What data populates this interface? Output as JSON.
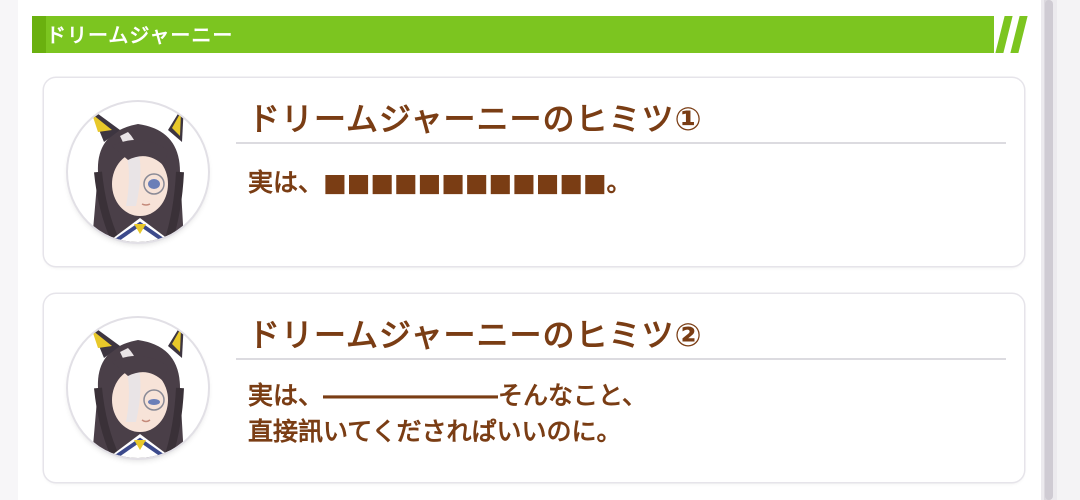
{
  "section": {
    "title": "ドリームジャーニー"
  },
  "cards": [
    {
      "title": "ドリームジャーニーのヒミツ①",
      "body_lines": [
        "実は、■■■■■■■■■■■■。"
      ]
    },
    {
      "title": "ドリームジャーニーのヒミツ②",
      "body_lines": [
        "実は、―――――――そんなこと、",
        "直接訊いてくだされぱいいのに。"
      ]
    }
  ],
  "colors": {
    "header_green": "#7cc520",
    "text_brown": "#7a3d14",
    "card_border": "#e6e4ea"
  },
  "icons": [
    "character-portrait-icon"
  ]
}
